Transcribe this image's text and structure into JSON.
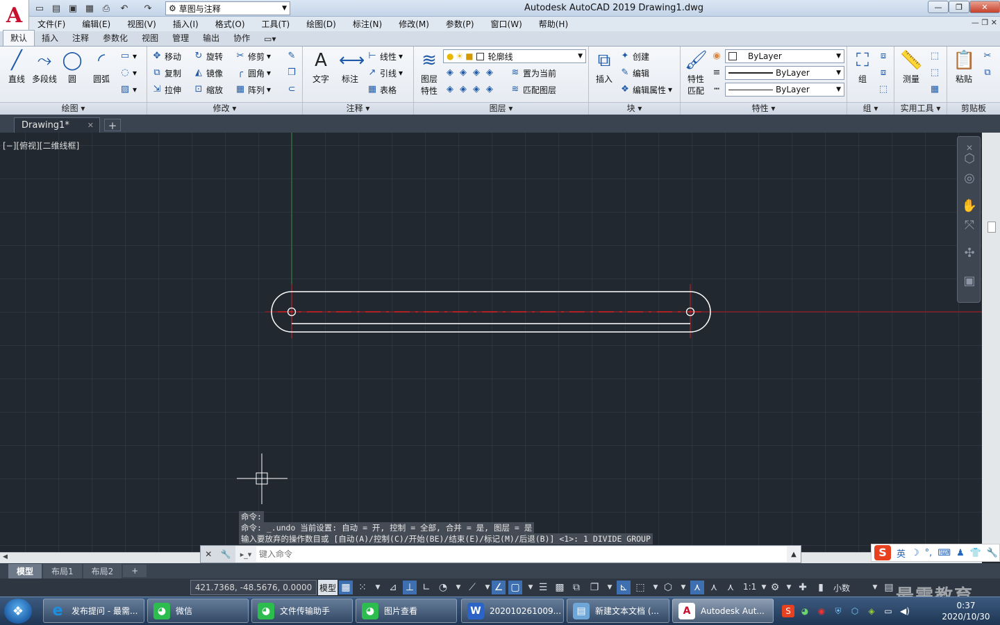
{
  "window": {
    "title": "Autodesk AutoCAD 2019    Drawing1.dwg",
    "workspace": "草图与注释",
    "logo_letter": "A"
  },
  "menu": [
    "文件(F)",
    "编辑(E)",
    "视图(V)",
    "插入(I)",
    "格式(O)",
    "工具(T)",
    "绘图(D)",
    "标注(N)",
    "修改(M)",
    "参数(P)",
    "窗口(W)",
    "帮助(H)"
  ],
  "ribbon_tabs": [
    "默认",
    "插入",
    "注释",
    "参数化",
    "视图",
    "管理",
    "输出",
    "协作"
  ],
  "ribbon": {
    "draw": {
      "title": "绘图",
      "line": "直线",
      "polyline": "多段线",
      "circle": "圆",
      "arc": "圆弧"
    },
    "modify": {
      "title": "修改",
      "move": "移动",
      "rotate": "旋转",
      "trim": "修剪",
      "copy": "复制",
      "mirror": "镜像",
      "fillet": "圆角",
      "stretch": "拉伸",
      "scale": "缩放",
      "array": "阵列"
    },
    "annotation": {
      "title": "注释",
      "text": "文字",
      "dimension": "标注",
      "linear": "线性",
      "leader": "引线",
      "table": "表格"
    },
    "layers": {
      "title": "图层",
      "layer_props_1": "图层",
      "layer_props_2": "特性",
      "current_layer": "轮廓线",
      "set_current": "置为当前",
      "match_layer": "匹配图层"
    },
    "block": {
      "title": "块",
      "insert": "插入",
      "create": "创建",
      "edit": "编辑",
      "edit_attr": "编辑属性"
    },
    "properties": {
      "title": "特性",
      "match_1": "特性",
      "match_2": "匹配",
      "color": "ByLayer",
      "linetype": "ByLayer",
      "lineweight": "ByLayer"
    },
    "groups": {
      "title": "组",
      "group": "组"
    },
    "utilities": {
      "title": "实用工具",
      "measure": "测量"
    },
    "clipboard": {
      "title": "剪贴板",
      "paste": "粘贴"
    }
  },
  "file_tab": {
    "name": "Drawing1*",
    "new": "+"
  },
  "viewport_label": "[−][俯视][二维线框]",
  "command": {
    "history": [
      "命令:",
      "命令: _.undo 当前设置: 自动 = 开, 控制 = 全部, 合并 = 是, 图层 = 是",
      "输入要放弃的操作数目或 [自动(A)/控制(C)/开始(BE)/结束(E)/标记(M)/后退(B)] <1>: 1 DIVIDE GROUP"
    ],
    "placeholder": "键入命令"
  },
  "layout_tabs": [
    "模型",
    "布局1",
    "布局2",
    "+"
  ],
  "status": {
    "coords": "421.7368, -48.5676, 0.0000",
    "model": "模型",
    "scale": "1:1",
    "units": "小数"
  },
  "ime": {
    "label": "英"
  },
  "taskbar": {
    "tasks": [
      {
        "label": "发布提问 - 最需...",
        "icon": "ie-icon",
        "color": "#1c8fe0"
      },
      {
        "label": "微信",
        "icon": "wechat-icon",
        "color": "#2dbd4e"
      },
      {
        "label": "文件传输助手",
        "icon": "wechat-icon",
        "color": "#2dbd4e"
      },
      {
        "label": "图片查看",
        "icon": "wechat-icon",
        "color": "#2dbd4e"
      },
      {
        "label": "202010261009...",
        "icon": "word-icon",
        "color": "#2b64c6"
      },
      {
        "label": "新建文本文档 (...",
        "icon": "notepad-icon",
        "color": "#6fa6d8"
      },
      {
        "label": "Autodesk Aut...",
        "icon": "autocad-icon",
        "color": "#c8102e"
      }
    ],
    "time": "0:37",
    "date": "2020/10/30"
  },
  "watermark": "最需教育",
  "colors": {
    "canvas_bg": "#212830",
    "grid": "#2d3541",
    "geometry": "#ffffff",
    "center_line": "#e01e1e",
    "ucs_y_axis": "#2e8b3a"
  }
}
